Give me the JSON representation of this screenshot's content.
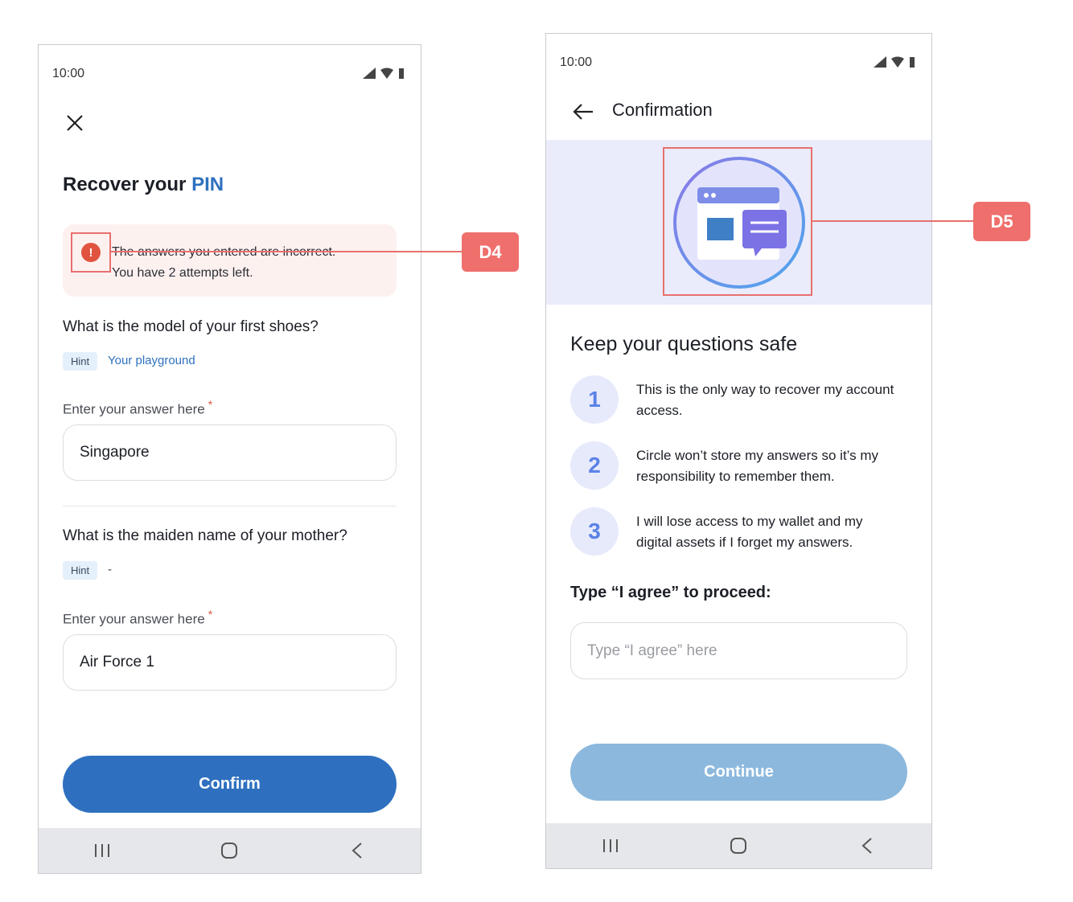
{
  "colors": {
    "accent": "#2e70bf",
    "error": "#e0543f",
    "callout": "#ef6f6c",
    "disabled_button": "#8cb8dd"
  },
  "screen1": {
    "status_time": "10:00",
    "title_prefix": "Recover your",
    "title_highlight": "PIN",
    "error_line1": "The answers you entered are incorrect.",
    "error_line2": "You have 2 attempts left.",
    "error_icon_glyph": "!",
    "questions": [
      {
        "question": "What is the model of your first shoes?",
        "hint_label": "Hint",
        "hint": "Your playground",
        "field_label": "Enter your answer here",
        "required": "*",
        "value": "Singapore"
      },
      {
        "question": "What is the maiden name of your mother?",
        "hint_label": "Hint",
        "hint": "-",
        "field_label": "Enter your answer here",
        "required": "*",
        "value": "Air Force 1"
      }
    ],
    "confirm_label": "Confirm"
  },
  "screen2": {
    "status_time": "10:00",
    "header_title": "Confirmation",
    "section_title": "Keep your questions safe",
    "steps": [
      {
        "num": "1",
        "text": "This is the only way to recover my account access."
      },
      {
        "num": "2",
        "text": "Circle won’t store my answers so it’s my responsibility to remember them."
      },
      {
        "num": "3",
        "text": "I will lose access to my wallet and my digital assets if I forget my answers."
      }
    ],
    "agree_label": "Type “I agree” to proceed:",
    "agree_placeholder": "Type “I agree” here",
    "continue_label": "Continue"
  },
  "callouts": {
    "d4": "D4",
    "d5": "D5"
  },
  "icons": {
    "close": "close-icon",
    "back": "arrow-left-icon",
    "error": "error-icon",
    "illustration": "chat-window-illustration"
  }
}
